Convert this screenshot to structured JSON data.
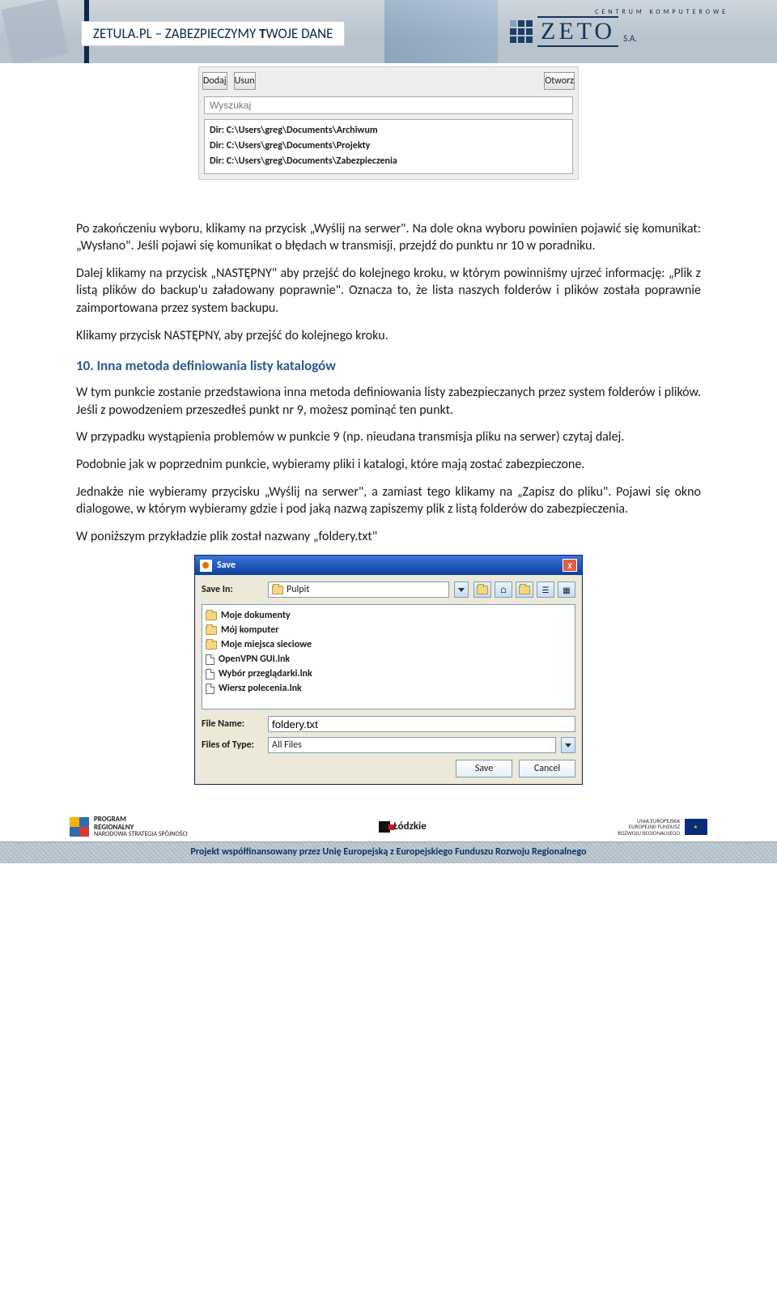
{
  "banner": {
    "title_prefix": "ZETULA.PL – ZABEZPIECZYMY ",
    "title_bold": "T",
    "title_suffix": "WOJE DANE",
    "zeto_top": "CENTRUM KOMPUTEROWE",
    "zeto_text": "ZETO",
    "zeto_sa": "S.A."
  },
  "app": {
    "btn_add": "Dodaj",
    "btn_del": "Usun",
    "btn_open": "Otworz",
    "search_placeholder": "Wyszukaj",
    "dirs": [
      "Dir: C:\\Users\\greg\\Documents\\Archiwum",
      "Dir: C:\\Users\\greg\\Documents\\Projekty",
      "Dir: C:\\Users\\greg\\Documents\\Zabezpieczenia"
    ]
  },
  "para": {
    "p1": "Po zakończeniu wyboru, klikamy na przycisk „Wyślij na serwer\". Na dole okna wyboru powinien pojawić się komunikat: „Wysłano\". Jeśli pojawi się komunikat o błędach w transmisji, przejdź do punktu nr 10 w poradniku.",
    "p2": "Dalej klikamy na przycisk „NASTĘPNY\" aby przejść do kolejnego kroku, w którym powinniśmy ujrzeć informację: „Plik z listą plików do backup'u załadowany poprawnie\". Oznacza to, że lista naszych folderów i plików została poprawnie zaimportowana przez system backupu.",
    "p3": "Klikamy przycisk NASTĘPNY, aby przejść do kolejnego kroku.",
    "section": "10. Inna metoda definiowania listy katalogów",
    "p4": " W tym punkcie zostanie przedstawiona inna metoda definiowania listy zabezpieczanych przez system folderów i plików. Jeśli  z powodzeniem przeszedłeś  punkt nr 9, możesz pominąć ten punkt.",
    "p5": "W przypadku wystąpienia problemów w punkcie 9 (np. nieudana transmisja pliku na serwer) czytaj dalej.",
    "p6": "Podobnie jak w poprzednim punkcie, wybieramy pliki i katalogi, które mają zostać zabezpieczone.",
    "p7": "Jednakże nie wybieramy przycisku  „Wyślij na serwer\", a zamiast tego klikamy na „Zapisz do pliku\". Pojawi się okno dialogowe, w którym wybieramy gdzie i pod jaką nazwą zapiszemy plik z listą folderów do zabezpieczenia.",
    "p8": "W poniższym przykładzie plik został nazwany „foldery.txt\""
  },
  "save": {
    "title": "Save",
    "label_savein": "Save In:",
    "savein_value": "Pulpit",
    "items": [
      {
        "name": "Moje dokumenty",
        "type": "folder"
      },
      {
        "name": "Mój komputer",
        "type": "folder"
      },
      {
        "name": "Moje miejsca sieciowe",
        "type": "folder"
      },
      {
        "name": "OpenVPN GUI.lnk",
        "type": "file"
      },
      {
        "name": "Wybór przeglądarki.lnk",
        "type": "file"
      },
      {
        "name": "Wiersz polecenia.lnk",
        "type": "file"
      }
    ],
    "label_filename": "File Name:",
    "filename_value": "foldery.txt",
    "label_filetype": "Files of Type:",
    "filetype_value": "All Files",
    "btn_save": "Save",
    "btn_cancel": "Cancel"
  },
  "footer": {
    "left1": "PROGRAM",
    "left2": "REGIONALNY",
    "left3": "NARODOWA STRATEGIA SPÓJNOŚCI",
    "mid": "Łódzkie",
    "right1": "UNIA EUROPEJSKA",
    "right2": "EUROPEJSKI FUNDUSZ",
    "right3": "ROZWOJU REGIONALNEGO",
    "bar": "Projekt współfinansowany przez Unię Europejską z Europejskiego Funduszu Rozwoju Regionalnego"
  }
}
